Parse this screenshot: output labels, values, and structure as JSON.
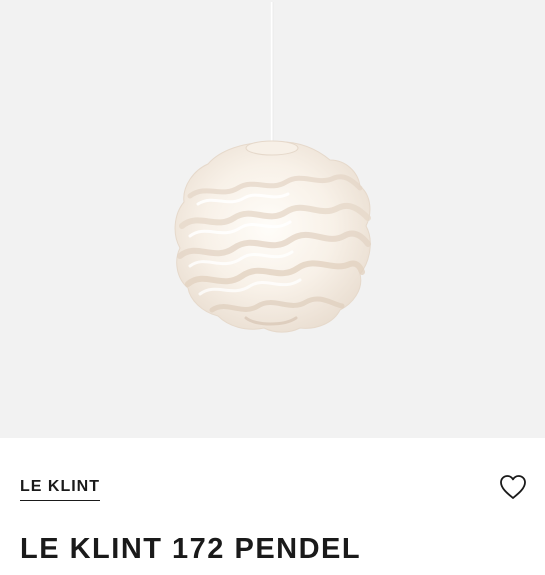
{
  "product": {
    "brand": "LE KLINT",
    "title": "LE KLINT 172 PENDEL"
  },
  "icons": {
    "favorite": "heart-outline-icon"
  },
  "colors": {
    "image_background": "#f2f2f2",
    "text": "#1a1a1a",
    "lamp_shade": "#faf6f1"
  }
}
